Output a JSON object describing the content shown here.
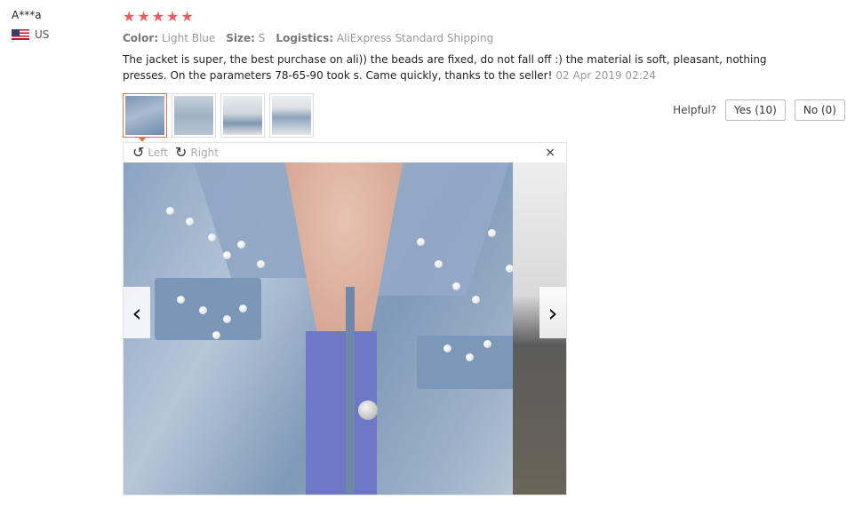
{
  "user": {
    "name": "A***a",
    "country": "US"
  },
  "review": {
    "rating": 5,
    "stars": [
      "★",
      "★",
      "★",
      "★",
      "★"
    ],
    "attributes": [
      {
        "key": "Color:",
        "value": "Light Blue"
      },
      {
        "key": "Size:",
        "value": "S"
      },
      {
        "key": "Logistics:",
        "value": "AliExpress Standard Shipping"
      }
    ],
    "text": "The jacket is super, the best purchase on ali)) the beads are fixed, do not fall off :) the material is soft, pleasant, nothing presses. On the parameters 78-65-90 took s. Came quickly, thanks to the seller!",
    "date": "02 Apr 2019 02:24"
  },
  "helpful": {
    "label": "Helpful?",
    "yes": "Yes (10)",
    "no": "No (0)"
  },
  "viewer": {
    "rotate_left": "Left",
    "rotate_right": "Right",
    "rotate_left_icon": "↺",
    "rotate_right_icon": "↻",
    "close_icon": "×",
    "prev_icon": "‹",
    "next_icon": "›"
  },
  "colors": {
    "star": "#f05b5b",
    "active_thumb": "#e8733a"
  }
}
